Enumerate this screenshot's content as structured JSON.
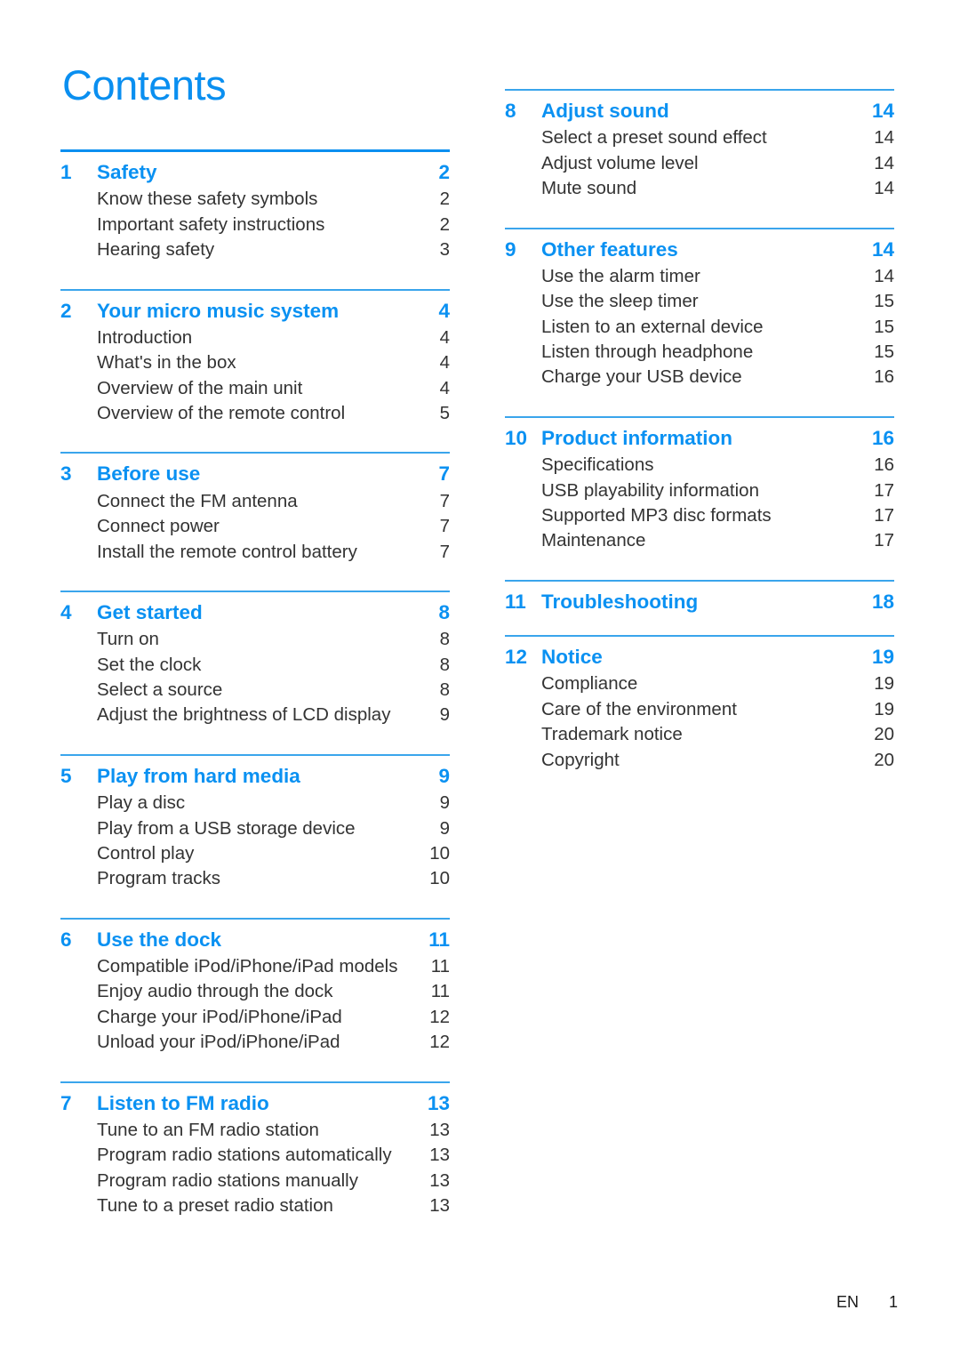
{
  "document": {
    "title": "Contents",
    "accent_color_strong": "#0a8ff0",
    "accent_color_rule": "#3aa5ec",
    "body_text_color": "#333333"
  },
  "footer": {
    "language": "EN",
    "page_number": "1"
  },
  "columns": {
    "left": [
      {
        "number": "1",
        "title": "Safety",
        "page": "2",
        "items": [
          {
            "title": "Know these safety symbols",
            "page": "2"
          },
          {
            "title": "Important safety instructions",
            "page": "2"
          },
          {
            "title": "Hearing safety",
            "page": "3"
          }
        ]
      },
      {
        "number": "2",
        "title": "Your micro music system",
        "page": "4",
        "items": [
          {
            "title": "Introduction",
            "page": "4"
          },
          {
            "title": "What's in the box",
            "page": "4"
          },
          {
            "title": "Overview of the main unit",
            "page": "4"
          },
          {
            "title": "Overview of the remote control",
            "page": "5"
          }
        ]
      },
      {
        "number": "3",
        "title": "Before use",
        "page": "7",
        "items": [
          {
            "title": "Connect the FM antenna",
            "page": "7"
          },
          {
            "title": "Connect power",
            "page": "7"
          },
          {
            "title": "Install the remote control battery",
            "page": "7"
          }
        ]
      },
      {
        "number": "4",
        "title": "Get started",
        "page": "8",
        "items": [
          {
            "title": "Turn on",
            "page": "8"
          },
          {
            "title": "Set the clock",
            "page": "8"
          },
          {
            "title": "Select a source",
            "page": "8"
          },
          {
            "title": "Adjust the brightness of LCD display",
            "page": "9"
          }
        ]
      },
      {
        "number": "5",
        "title": "Play from hard media",
        "page": "9",
        "items": [
          {
            "title": "Play a disc",
            "page": "9"
          },
          {
            "title": "Play from a USB storage device",
            "page": "9"
          },
          {
            "title": "Control play",
            "page": "10"
          },
          {
            "title": "Program tracks",
            "page": "10"
          }
        ]
      },
      {
        "number": "6",
        "title": "Use the dock",
        "page": "11",
        "items": [
          {
            "title": "Compatible iPod/iPhone/iPad models",
            "page": "11"
          },
          {
            "title": "Enjoy audio through the dock",
            "page": "11"
          },
          {
            "title": "Charge your iPod/iPhone/iPad",
            "page": "12"
          },
          {
            "title": "Unload your iPod/iPhone/iPad",
            "page": "12"
          }
        ]
      },
      {
        "number": "7",
        "title": "Listen to FM radio",
        "page": "13",
        "items": [
          {
            "title": "Tune to an FM radio station",
            "page": "13"
          },
          {
            "title": "Program radio stations automatically",
            "page": "13"
          },
          {
            "title": "Program radio stations manually",
            "page": "13"
          },
          {
            "title": "Tune to a preset radio station",
            "page": "13"
          }
        ]
      }
    ],
    "right": [
      {
        "number": "8",
        "title": "Adjust sound",
        "page": "14",
        "items": [
          {
            "title": "Select a preset sound effect",
            "page": "14"
          },
          {
            "title": "Adjust volume level",
            "page": "14"
          },
          {
            "title": "Mute sound",
            "page": "14"
          }
        ]
      },
      {
        "number": "9",
        "title": "Other features",
        "page": "14",
        "items": [
          {
            "title": "Use the alarm timer",
            "page": "14"
          },
          {
            "title": "Use the sleep timer",
            "page": "15"
          },
          {
            "title": "Listen to an external device",
            "page": "15"
          },
          {
            "title": "Listen through headphone",
            "page": "15"
          },
          {
            "title": "Charge your USB device",
            "page": "16"
          }
        ]
      },
      {
        "number": "10",
        "title": "Product information",
        "page": "16",
        "items": [
          {
            "title": "Specifications",
            "page": "16"
          },
          {
            "title": "USB playability information",
            "page": "17"
          },
          {
            "title": "Supported MP3 disc formats",
            "page": "17"
          },
          {
            "title": "Maintenance",
            "page": "17"
          }
        ]
      },
      {
        "number": "11",
        "title": "Troubleshooting",
        "page": "18",
        "items": []
      },
      {
        "number": "12",
        "title": "Notice",
        "page": "19",
        "items": [
          {
            "title": "Compliance",
            "page": "19"
          },
          {
            "title": "Care of the environment",
            "page": "19"
          },
          {
            "title": "Trademark notice",
            "page": "20"
          },
          {
            "title": "Copyright",
            "page": "20"
          }
        ]
      }
    ]
  }
}
